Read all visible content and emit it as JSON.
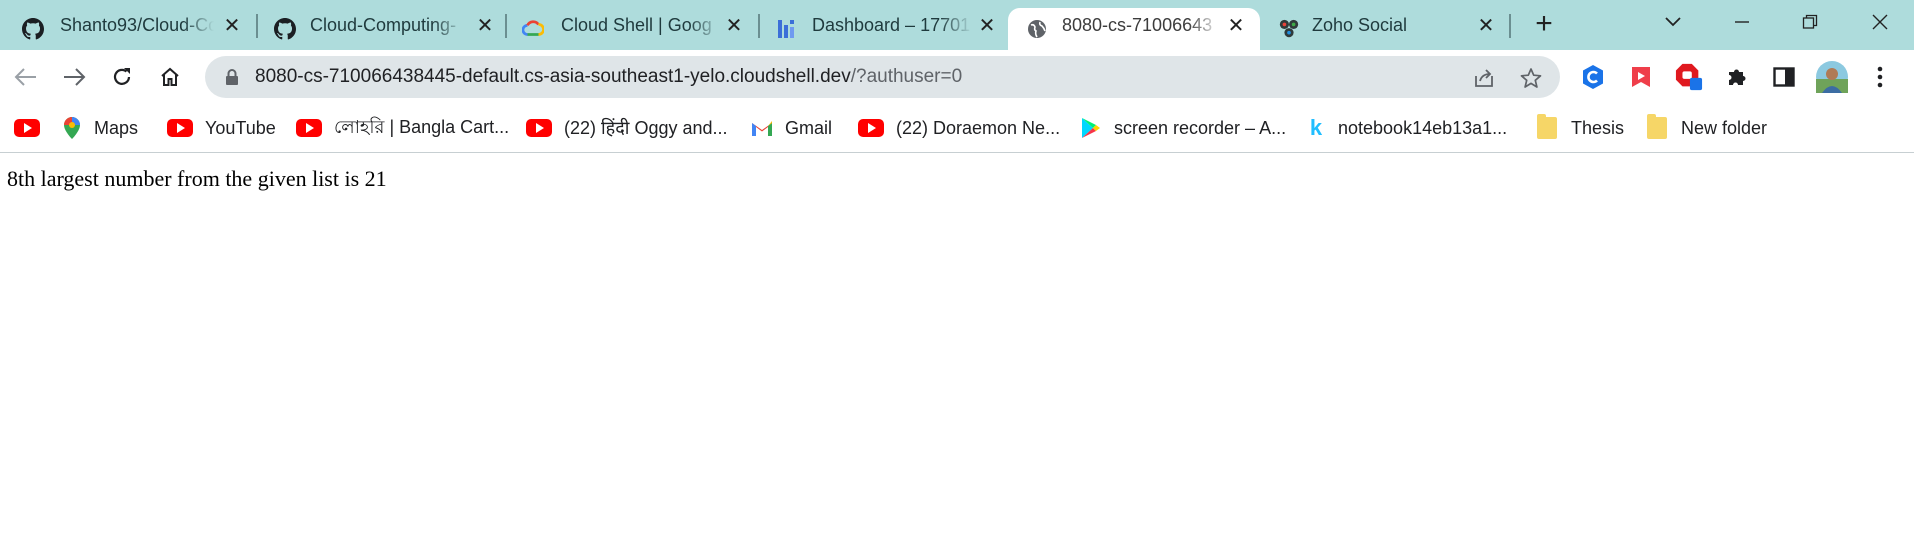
{
  "tabs": [
    {
      "title": "Shanto93/Cloud-Co",
      "favicon": "github-icon",
      "active": false
    },
    {
      "title": "Cloud-Computing-",
      "favicon": "github-icon",
      "active": false
    },
    {
      "title": "Cloud Shell | Goog",
      "favicon": "google-cloud-icon",
      "active": false
    },
    {
      "title": "Dashboard – 17701",
      "favicon": "dashboard-icon",
      "active": false
    },
    {
      "title": "8080-cs-71006643",
      "favicon": "globe-icon",
      "active": true
    },
    {
      "title": "Zoho Social",
      "favicon": "zoho-icon",
      "active": false
    }
  ],
  "address_bar": {
    "host": "8080-cs-710066438445-default.cs-asia-southeast1-yelo.cloudshell.dev",
    "path": "/?authuser=0"
  },
  "bookmarks": [
    {
      "label": "",
      "icon": "youtube-icon"
    },
    {
      "label": "Maps",
      "icon": "maps-icon"
    },
    {
      "label": "YouTube",
      "icon": "youtube-icon"
    },
    {
      "label": "লোহরি | Bangla Cart...",
      "icon": "youtube-icon"
    },
    {
      "label": "(22) हिंदी Oggy and...",
      "icon": "youtube-icon"
    },
    {
      "label": "Gmail",
      "icon": "gmail-icon"
    },
    {
      "label": "(22) Doraemon Ne...",
      "icon": "youtube-icon"
    },
    {
      "label": "screen recorder – A...",
      "icon": "play-store-icon"
    },
    {
      "label": "notebook14eb13a1...",
      "icon": "kaggle-icon"
    },
    {
      "label": "Thesis",
      "icon": "folder-icon"
    },
    {
      "label": "New folder",
      "icon": "folder-icon"
    }
  ],
  "page": {
    "result_text": "8th largest number from the given list is 21"
  },
  "colors": {
    "tabstrip": "#aedcdc",
    "omnibox": "#dfe5e8",
    "youtube_red": "#ff0000",
    "folder_yellow": "#f6d667"
  }
}
